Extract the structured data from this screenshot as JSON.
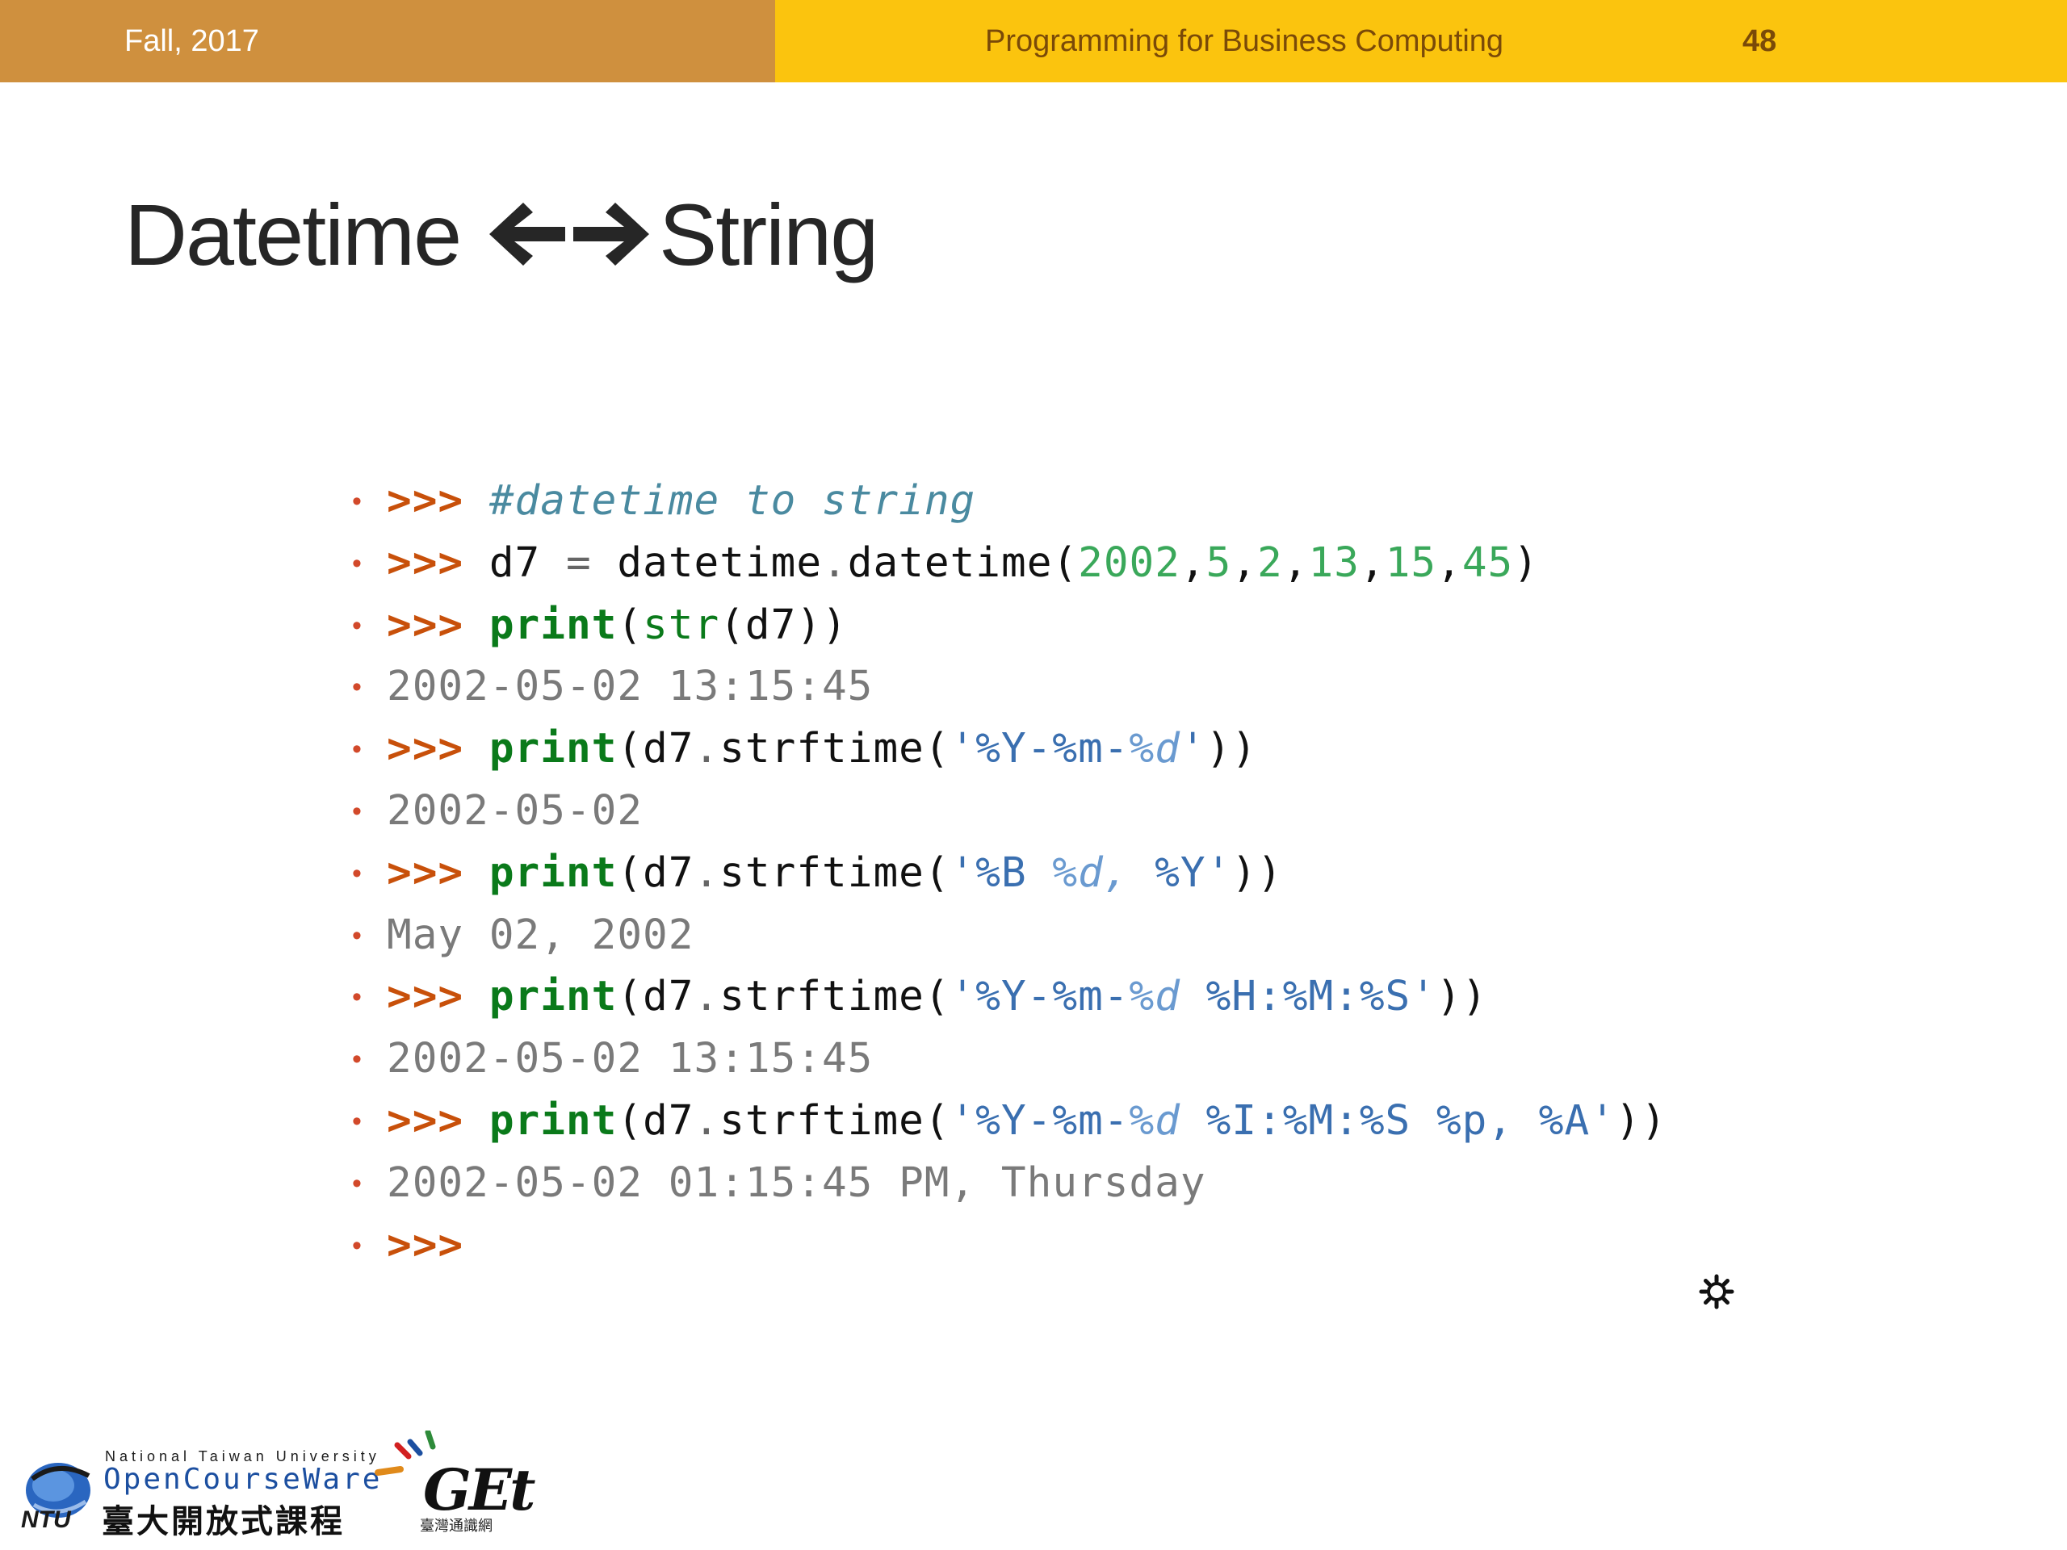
{
  "header": {
    "date": "Fall, 2017",
    "course": "Programming for Business Computing",
    "page": "48",
    "left_color": "#cf903e",
    "right_color": "#fbc40e"
  },
  "title": {
    "left": "Datetime",
    "right": "String",
    "arrows_icon": "left-right-arrows-icon"
  },
  "code": {
    "prompt": ">>>",
    "line1_comment": "#datetime to string",
    "line2": {
      "var": "d7",
      "eq": "=",
      "call": "datetime",
      "dot": ".",
      "func": "datetime(",
      "nums": [
        "2002",
        "5",
        "2",
        "13",
        "15",
        "45"
      ],
      "close": ")"
    },
    "line3": {
      "print": "print",
      "open": "(",
      "str": "str",
      "rest": "(d7))"
    },
    "line4_output": "2002-05-02 13:15:45",
    "line5": {
      "print": "print",
      "pre": "(d7",
      "dot": ".",
      "method": "strftime(",
      "fmt_a": "'%Y-%m-",
      "fmt_b": "%d",
      "fmt_c": "'",
      "close": "))"
    },
    "line6_output": "2002-05-02",
    "line7": {
      "print": "print",
      "pre": "(d7",
      "dot": ".",
      "method": "strftime(",
      "fmt_a": "'%B ",
      "fmt_b": "%d,",
      "fmt_c": " %Y'",
      "close": "))"
    },
    "line8_output": "May 02, 2002",
    "line9": {
      "print": "print",
      "pre": "(d7",
      "dot": ".",
      "method": "strftime(",
      "fmt_a": "'%Y-%m-",
      "fmt_b": "%d",
      "fmt_c": " %H:%M:%S'",
      "close": "))"
    },
    "line10_output": "2002-05-02 13:15:45",
    "line11": {
      "print": "print",
      "pre": "(d7",
      "dot": ".",
      "method": "strftime(",
      "fmt_a": "'%Y-%m-",
      "fmt_b": "%d",
      "fmt_c": " %I:%M:%S %p, %A'",
      "close": "))"
    },
    "line12_output": "2002-05-02 01:15:45 PM, Thursday"
  },
  "footer": {
    "ntu_small": "National Taiwan University",
    "ocw": "OpenCourseWare",
    "ocw_cn": "臺大開放式課程",
    "ntu_mark": "NTU",
    "get": "GEt",
    "get_sub": "臺灣通識網"
  },
  "colors": {
    "prompt": "#c8500a",
    "keyword": "#0a7a1a",
    "number": "#3aa85a",
    "string": "#3a6fb0",
    "output": "#7a7a7a",
    "bullet": "#d2492a"
  },
  "icons": [
    "left-right-arrows-icon",
    "gear-icon",
    "ntu-logo-icon",
    "get-logo-icon"
  ]
}
